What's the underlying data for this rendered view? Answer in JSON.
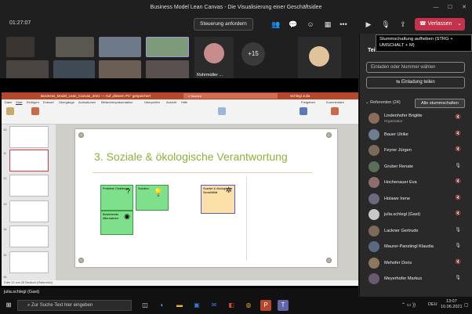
{
  "window": {
    "title": "Business Model Lean Canvas - Die Visualisierung einer Geschäftsidee"
  },
  "meeting": {
    "timer": "01:27:07",
    "request_control": "Steuerung anfordern",
    "leave": "Verlassen",
    "overflow_count": "+15"
  },
  "tiles": [
    {
      "name": ""
    },
    {
      "name": ""
    },
    {
      "name": ""
    },
    {
      "name": ""
    },
    {
      "name": ""
    },
    {
      "name": ""
    },
    {
      "name": ""
    },
    {
      "name": ""
    },
    {
      "name": "Rohrmüller ..."
    },
    {
      "name": ""
    }
  ],
  "ppt": {
    "filename": "Business_Model_Lean_Canvas_2021 — Auf „diesem PC“ gespeichert",
    "search": "Suchen",
    "user": "Schlegl Julia",
    "tabs": [
      "Datei",
      "Start",
      "Einfügen",
      "Entwurf",
      "Übergänge",
      "Animationen",
      "Bildschirmpräsentation",
      "Überprüfen",
      "Ansicht",
      "Hilfe"
    ],
    "share": "Freigeben",
    "comments": "Kommentare",
    "slide_numbers": [
      "10",
      "11",
      "12",
      "13",
      "14",
      "15",
      "16"
    ],
    "status": "Folie 12 von 26   Deutsch (Österreich)",
    "slide": {
      "title": "3. Soziale & ökologische Verantwortung",
      "cells": {
        "problem": "Problem/ Challenge",
        "solution": "Solution",
        "existing": "Bestehende Alternativen",
        "social": "Soziale & ökologische Sensibilität"
      }
    }
  },
  "presenter": "julia.schlegl (Gast)",
  "panel": {
    "title": "Tei",
    "tooltip": "Stummschaltung aufheben (STRG + UMSCHALT + M)",
    "invite_placeholder": "Einladen oder Nummer wählen",
    "share_invite": "Einladung teilen",
    "referents_label": "Referenten (24)",
    "mute_all": "Alle stummschalten",
    "participants": [
      {
        "name": "Lindenhofer Brigitte",
        "role": "Organisator",
        "color": "#8a6d5a"
      },
      {
        "name": "Bauer Ulrike",
        "role": "",
        "color": "#6d7f8e"
      },
      {
        "name": "Feyrer Jürgen",
        "role": "",
        "color": "#7a6a5a"
      },
      {
        "name": "Gruber Renate",
        "role": "",
        "color": "#5a6e5a"
      },
      {
        "name": "Hochenauer Eva",
        "role": "",
        "color": "#8e6d6d"
      },
      {
        "name": "Holawe Irene",
        "role": "",
        "color": "#6a6a7e"
      },
      {
        "name": "julia.schlegl (Gast)",
        "role": "",
        "color": "#c8c8c8"
      },
      {
        "name": "Lackner Gertrude",
        "role": "",
        "color": "#7e6a5a"
      },
      {
        "name": "Maurer-Panstingl Klaudia",
        "role": "",
        "color": "#5a6a7e"
      },
      {
        "name": "Mehofer Doris",
        "role": "",
        "color": "#8a7a5a"
      },
      {
        "name": "Meyerhofer Markus",
        "role": "",
        "color": "#6a5a6e"
      }
    ]
  },
  "taskbar": {
    "search": "Zur Suche Text hier eingeben",
    "lang": "DEU",
    "time": "13:07",
    "date": "10.06.2021"
  },
  "colors": {
    "accent": "#6264a7",
    "leave": "#c4314b",
    "ppt": "#b7472a",
    "slide_title": "#8db23a"
  }
}
